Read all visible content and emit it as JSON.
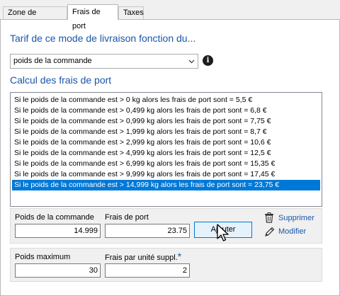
{
  "tabs": [
    {
      "label": "Zone de livraison"
    },
    {
      "label": "Frais de port"
    },
    {
      "label": "Taxes"
    }
  ],
  "tariff_heading": "Tarif de ce mode de livraison fonction du...",
  "tariff_select": {
    "selected": "poids de la commande"
  },
  "fees_heading": "Calcul des frais de port",
  "rules": [
    "Si le poids de la commande est > 0 kg alors les frais de port sont = 5,5 €",
    "Si le poids de la commande est > 0,499 kg alors les frais de port sont = 6,8 €",
    "Si le poids de la commande est > 0,999 kg alors les frais de port sont = 7,75 €",
    "Si le poids de la commande est > 1,999 kg alors les frais de port sont = 8,7 €",
    "Si le poids de la commande est > 2,999 kg alors les frais de port sont = 10,6 €",
    "Si le poids de la commande est > 4,999 kg alors les frais de port sont = 12,5 €",
    "Si le poids de la commande est > 6,999 kg alors les frais de port sont = 15,35 €",
    "Si le poids de la commande est > 9,999 kg alors les frais de port sont = 17,45 €",
    "Si le poids de la commande est > 14,999 kg alors les frais de port sont = 23,75 €"
  ],
  "selected_rule_index": 8,
  "edit": {
    "weight_label": "Poids de la commande",
    "weight_value": "14.999",
    "fee_label": "Frais de port",
    "fee_value": "23.75",
    "add_button": "Ajouter",
    "delete_link": "Supprimer",
    "modify_link": "Modifier"
  },
  "extra": {
    "max_weight_label": "Poids maximum",
    "max_weight_value": "30",
    "fee_per_unit_label": "Frais par unité suppl.",
    "required_mark": "*",
    "fee_per_unit_value": "2"
  },
  "colors": {
    "accent": "#1a55a8",
    "selection": "#0078d7"
  }
}
